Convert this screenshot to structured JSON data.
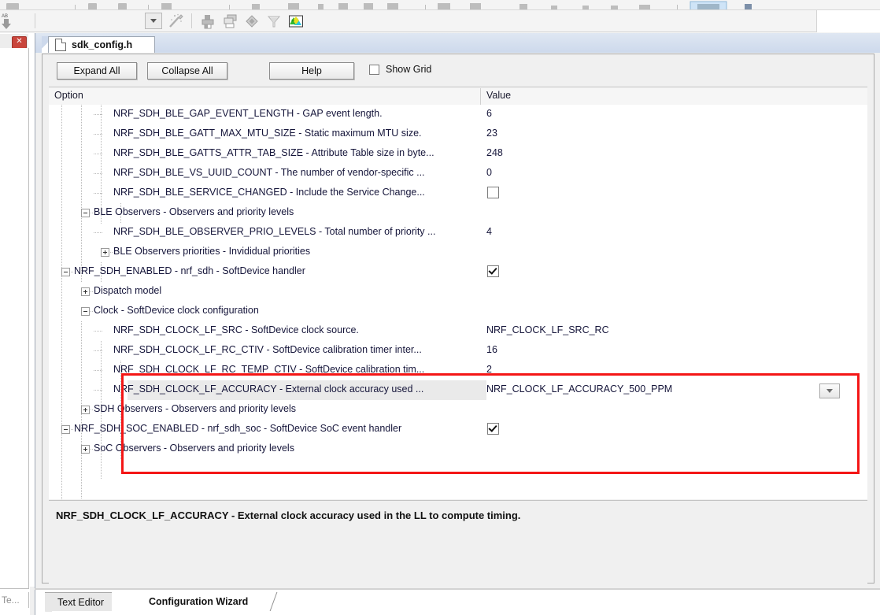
{
  "toolbar": {
    "icons": [
      {
        "name": "dropdown-button",
        "glyph": "chevron-down"
      },
      {
        "name": "magic-wand-icon",
        "glyph": "wand"
      },
      {
        "name": "build-icon",
        "glyph": "build"
      },
      {
        "name": "copy-icon",
        "glyph": "copy"
      },
      {
        "name": "diamond-icon",
        "glyph": "diamond"
      },
      {
        "name": "filter-icon",
        "glyph": "filter"
      },
      {
        "name": "map-icon",
        "glyph": "map"
      }
    ]
  },
  "left_panel": {
    "close_label": "✕",
    "bottom_tab_label": "Te..."
  },
  "editor": {
    "document_tab": "sdk_config.h"
  },
  "buttons": {
    "expand_all": "Expand All",
    "collapse_all": "Collapse All",
    "help": "Help",
    "show_grid": "Show Grid",
    "show_grid_checked": false
  },
  "tree": {
    "columns": [
      "Option",
      "Value"
    ],
    "rows": [
      {
        "indent": 4,
        "marker": "none",
        "option": "NRF_SDH_BLE_GAP_EVENT_LENGTH - GAP event length.",
        "value": "6",
        "value_type": "text"
      },
      {
        "indent": 4,
        "marker": "none",
        "option": "NRF_SDH_BLE_GATT_MAX_MTU_SIZE - Static maximum MTU size.",
        "value": "23",
        "value_type": "text"
      },
      {
        "indent": 4,
        "marker": "none",
        "option": "NRF_SDH_BLE_GATTS_ATTR_TAB_SIZE - Attribute Table size in byte...",
        "value": "248",
        "value_type": "text"
      },
      {
        "indent": 4,
        "marker": "none",
        "option": "NRF_SDH_BLE_VS_UUID_COUNT - The number of vendor-specific ...",
        "value": "0",
        "value_type": "text"
      },
      {
        "indent": 4,
        "marker": "none",
        "option": "NRF_SDH_BLE_SERVICE_CHANGED  - Include the Service Change...",
        "value": "",
        "value_type": "checkbox",
        "checked": false
      },
      {
        "indent": 3,
        "marker": "minus",
        "option": "BLE Observers - Observers and priority levels",
        "value": "",
        "value_type": "none"
      },
      {
        "indent": 4,
        "marker": "none",
        "option": "NRF_SDH_BLE_OBSERVER_PRIO_LEVELS - Total number of priority ...",
        "value": "4",
        "value_type": "text"
      },
      {
        "indent": 4,
        "marker": "plus",
        "option": "BLE Observers priorities - Invididual priorities",
        "value": "",
        "value_type": "none"
      },
      {
        "indent": 2,
        "marker": "minus",
        "option": "NRF_SDH_ENABLED - nrf_sdh - SoftDevice handler",
        "value": "",
        "value_type": "checkbox",
        "checked": true
      },
      {
        "indent": 3,
        "marker": "plus",
        "option": "Dispatch model",
        "value": "",
        "value_type": "none"
      },
      {
        "indent": 3,
        "marker": "minus",
        "option": "Clock - SoftDevice clock configuration",
        "value": "",
        "value_type": "none"
      },
      {
        "indent": 4,
        "marker": "none",
        "option": "NRF_SDH_CLOCK_LF_SRC  - SoftDevice clock source.",
        "value": "NRF_CLOCK_LF_SRC_RC",
        "value_type": "text"
      },
      {
        "indent": 4,
        "marker": "none",
        "option": "NRF_SDH_CLOCK_LF_RC_CTIV - SoftDevice calibration timer inter...",
        "value": "16",
        "value_type": "text"
      },
      {
        "indent": 4,
        "marker": "none",
        "option": "NRF_SDH_CLOCK_LF_RC_TEMP_CTIV - SoftDevice calibration tim...",
        "value": "2",
        "value_type": "text"
      },
      {
        "indent": 4,
        "marker": "none",
        "option": "NRF_SDH_CLOCK_LF_ACCURACY  - External clock accuracy used ...",
        "value": "NRF_CLOCK_LF_ACCURACY_500_PPM",
        "value_type": "dropdown",
        "selected": true
      },
      {
        "indent": 3,
        "marker": "plus",
        "option": "SDH Observers - Observers and priority levels",
        "value": "",
        "value_type": "none"
      },
      {
        "indent": 2,
        "marker": "minus",
        "option": "NRF_SDH_SOC_ENABLED - nrf_sdh_soc - SoftDevice SoC event handler",
        "value": "",
        "value_type": "checkbox",
        "checked": true
      },
      {
        "indent": 3,
        "marker": "plus",
        "option": "SoC Observers - Observers and priority levels",
        "value": "",
        "value_type": "none"
      }
    ]
  },
  "description": {
    "text": "NRF_SDH_CLOCK_LF_ACCURACY  - External clock accuracy used in the LL to compute timing."
  },
  "bottom_tabs": {
    "text_editor": "Text Editor",
    "configuration_wizard": "Configuration Wizard"
  },
  "annotation": {
    "color": "#f41616"
  }
}
